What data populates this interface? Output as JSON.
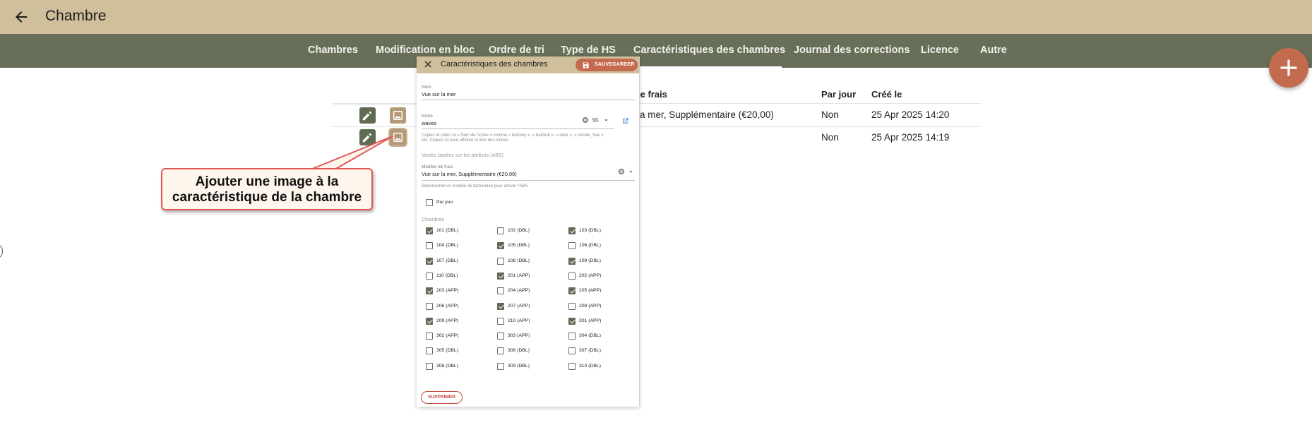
{
  "header": {
    "title": "Chambre"
  },
  "tabs": [
    {
      "label": "Chambres",
      "active": false
    },
    {
      "label": "Modification en bloc",
      "active": false
    },
    {
      "label": "Ordre de tri",
      "active": false
    },
    {
      "label": "Type de HS",
      "active": false
    },
    {
      "label": "Caractéristiques des chambres",
      "active": true
    },
    {
      "label": "Journal des corrections",
      "active": false
    },
    {
      "label": "Licence",
      "active": false
    },
    {
      "label": "Autre",
      "active": false
    }
  ],
  "table": {
    "headers": {
      "model": "le frais",
      "per_day": "Par jour",
      "created": "Créé le"
    },
    "rows": [
      {
        "model": "la mer, Supplémentaire (€20,00)",
        "per_day": "Non",
        "created": "25 Apr 2025 14:20"
      },
      {
        "model": "",
        "per_day": "Non",
        "created": "25 Apr 2025 14:19"
      }
    ]
  },
  "callout": {
    "line1": "Ajouter une image à la",
    "line2": "caractéristique de la chambre"
  },
  "panel": {
    "title": "Caractéristiques des chambres",
    "save_label": "SAUVEGARDER",
    "name_label": "Nom",
    "name_value": "Vue sur la mer",
    "icon_label": "Icône",
    "icon_value": "waves",
    "icon_hint_1": "Copiez et collez le « Nom de l'icône » comme « balcony », « bathtub », « desk », « smoke_free »,",
    "icon_hint_2": "etc. Cliquez ici pour afficher la liste des icônes.",
    "abs_section": "Ventes basées sur les attributs (ABS)",
    "model_label": "Modèle de frais",
    "model_value": "Vue sur la mer, Supplémentaire (€20,00)",
    "model_hint": "Sélectionner un modèle de facturation pour activer l'ABS",
    "per_day_label": "Par jour",
    "per_day_checked": false,
    "rooms_section": "Chambres",
    "rooms": [
      {
        "label": "101 (DBL)",
        "checked": true
      },
      {
        "label": "102 (DBL)",
        "checked": false
      },
      {
        "label": "103 (DBL)",
        "checked": true
      },
      {
        "label": "104 (DBL)",
        "checked": false
      },
      {
        "label": "105 (DBL)",
        "checked": true
      },
      {
        "label": "106 (DBL)",
        "checked": false
      },
      {
        "label": "107 (DBL)",
        "checked": true
      },
      {
        "label": "108 (DBL)",
        "checked": false
      },
      {
        "label": "109 (DBL)",
        "checked": true
      },
      {
        "label": "110 (DBL)",
        "checked": false
      },
      {
        "label": "201 (APP)",
        "checked": true
      },
      {
        "label": "202 (APP)",
        "checked": false
      },
      {
        "label": "203 (APP)",
        "checked": true
      },
      {
        "label": "204 (APP)",
        "checked": false
      },
      {
        "label": "205 (APP)",
        "checked": true
      },
      {
        "label": "206 (APP)",
        "checked": false
      },
      {
        "label": "207 (APP)",
        "checked": true
      },
      {
        "label": "208 (APP)",
        "checked": false
      },
      {
        "label": "209 (APP)",
        "checked": true
      },
      {
        "label": "210 (APP)",
        "checked": false
      },
      {
        "label": "301 (APP)",
        "checked": true
      },
      {
        "label": "302 (APP)",
        "checked": false
      },
      {
        "label": "303 (APP)",
        "checked": false
      },
      {
        "label": "304 (DBL)",
        "checked": false
      },
      {
        "label": "305 (DBL)",
        "checked": false
      },
      {
        "label": "306 (DBL)",
        "checked": false
      },
      {
        "label": "307 (DBL)",
        "checked": false
      },
      {
        "label": "308 (DBL)",
        "checked": false
      },
      {
        "label": "309 (DBL)",
        "checked": false
      },
      {
        "label": "310 (DBL)",
        "checked": false
      }
    ],
    "delete_label": "SUPPRIMER"
  },
  "colors": {
    "topbar": "#cfbf9b",
    "navbar": "#676f58",
    "accent": "#c36a4f",
    "checkbox": "#606a55",
    "callout_border": "#e05858"
  },
  "icons": {
    "back": "arrow-left-icon",
    "fab": "plus-icon",
    "edit": "pencil-icon",
    "image": "image-icon",
    "close": "close-icon",
    "save": "floppy-disk-icon",
    "clear": "clear-circle-icon",
    "dropdown": "chevron-down-icon",
    "icon_preview": "waves-icon",
    "open_external": "open-in-new-icon"
  }
}
